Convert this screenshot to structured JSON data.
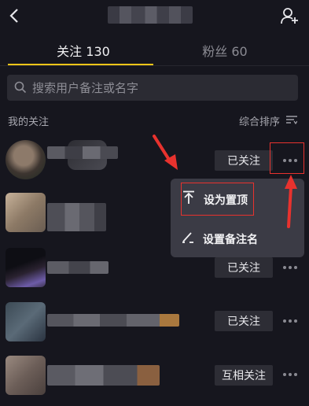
{
  "header": {
    "back_icon": "chevron-left-icon",
    "add_user_icon": "add-user-icon"
  },
  "tabs": [
    {
      "label": "关注 130",
      "active": true
    },
    {
      "label": "粉丝 60",
      "active": false
    }
  ],
  "search": {
    "placeholder": "搜索用户备注或名字"
  },
  "list": {
    "section_title": "我的关注",
    "sort_label": "综合排序"
  },
  "rows": [
    {
      "button": "已关注"
    },
    {
      "button": ""
    },
    {
      "button": "已关注"
    },
    {
      "button": "已关注"
    },
    {
      "button": "互相关注"
    }
  ],
  "menu": {
    "items": [
      {
        "label": "设为置顶",
        "icon": "pin-top-icon"
      },
      {
        "label": "设置备注名",
        "icon": "edit-icon"
      }
    ]
  },
  "colors": {
    "accent": "#f5c518",
    "annotation_red": "#e8322e",
    "background": "#16161e"
  }
}
